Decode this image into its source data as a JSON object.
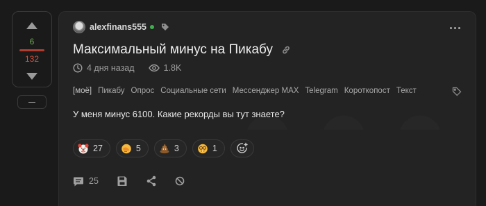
{
  "vote": {
    "pluses": "6",
    "minuses": "132"
  },
  "post": {
    "author": "alexfinans555",
    "title": "Максимальный минус на Пикабу",
    "time": "4 дня назад",
    "views": "1.8K",
    "tags": [
      "[моё]",
      "Пикабу",
      "Опрос",
      "Социальные сети",
      "Мессенджер MAX",
      "Telegram",
      "Короткопост",
      "Текст"
    ],
    "text": "У меня минус 6100. Какие рекорды вы тут знаете?"
  },
  "reactions": [
    {
      "icon": "clown-face-icon",
      "count": "27"
    },
    {
      "icon": "facepalm-icon",
      "count": "5"
    },
    {
      "icon": "poop-icon",
      "count": "3"
    },
    {
      "icon": "nerd-face-icon",
      "count": "1"
    }
  ],
  "footer": {
    "comments": "25"
  },
  "colors": {
    "background": "#1a1a1a",
    "card": "#232323",
    "plus": "#6aa84f",
    "minus": "#d0533f",
    "online": "#3fae4e"
  }
}
